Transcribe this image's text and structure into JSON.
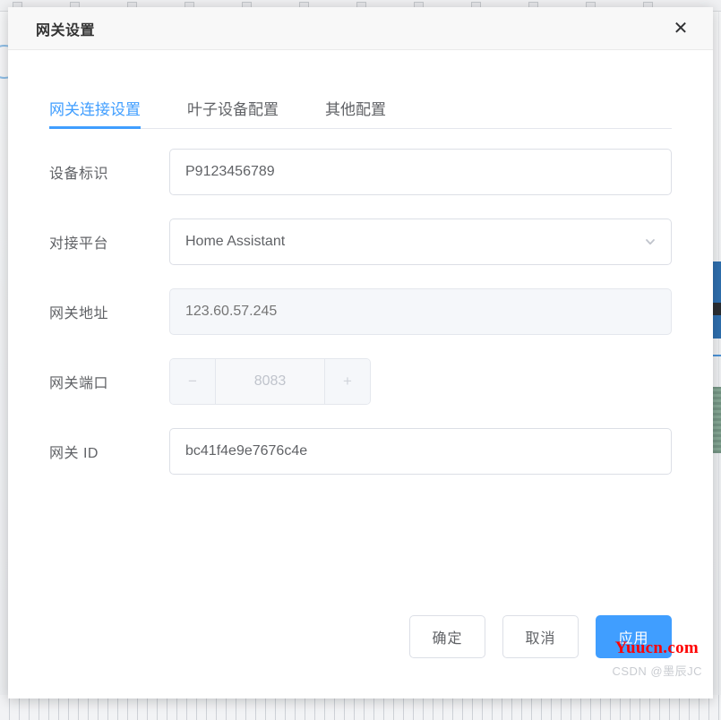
{
  "background": {
    "description": "faint desktop application behind modal",
    "toolbar_tick_count": 12
  },
  "dialog": {
    "title": "网关设置",
    "close_icon": "close-icon",
    "close_glyph": "✕"
  },
  "tabs": [
    {
      "label": "网关连接设置",
      "active": true
    },
    {
      "label": "叶子设备配置",
      "active": false
    },
    {
      "label": "其他配置",
      "active": false
    }
  ],
  "form": {
    "fields": [
      {
        "label": "设备标识",
        "type": "text",
        "value": "P9123456789",
        "placeholder": "",
        "disabled": false
      },
      {
        "label": "对接平台",
        "type": "select",
        "value": "Home Assistant",
        "placeholder": "",
        "disabled": false,
        "icon": "chevron-down-icon"
      },
      {
        "label": "网关地址",
        "type": "text",
        "value": "123.60.57.245",
        "placeholder": "123.60.57.245",
        "disabled": true
      },
      {
        "label": "网关端口",
        "type": "number",
        "value": "8083",
        "disabled": true,
        "decrement_glyph": "−",
        "increment_glyph": "+"
      },
      {
        "label": "网关 ID",
        "type": "text",
        "value": "bc41f4e9e7676c4e",
        "placeholder": "",
        "disabled": false
      }
    ]
  },
  "footer": {
    "confirm_label": "确定",
    "cancel_label": "取消",
    "apply_label": "应用"
  },
  "watermarks": {
    "site": "Yuucn.com",
    "author": "CSDN @墨辰JC"
  },
  "colors": {
    "primary": "#409eff",
    "text": "#606266",
    "title": "#333333",
    "border": "#dcdfe6",
    "disabled_bg": "#f5f7fa",
    "disabled_text": "#c0c4cc",
    "watermark_red": "#ff0000"
  }
}
